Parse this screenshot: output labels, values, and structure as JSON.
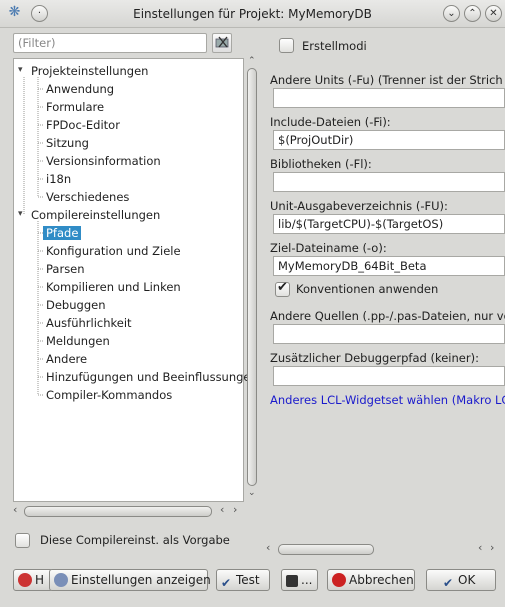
{
  "window": {
    "title": "Einstellungen für Projekt: MyMemoryDB"
  },
  "filter": {
    "placeholder": "(Filter)"
  },
  "tree": {
    "group1": "Projekteinstellungen",
    "group1_items": [
      "Anwendung",
      "Formulare",
      "FPDoc-Editor",
      "Sitzung",
      "Versionsinformation",
      "i18n",
      "Verschiedenes"
    ],
    "group2": "Compilereinstellungen",
    "group2_items": [
      "Pfade",
      "Konfiguration und Ziele",
      "Parsen",
      "Kompilieren und Linken",
      "Debuggen",
      "Ausführlichkeit",
      "Meldungen",
      "Andere",
      "Hinzufügungen und Beeinflussungen",
      "Compiler-Kommandos"
    ],
    "selected": "Pfade"
  },
  "default_checkbox": {
    "label": "Diese Compilereinst. als Vorgabe"
  },
  "paths": {
    "buildmodes": "Erstellmodi",
    "other_units_label": "Andere Units (-Fu) (Trenner ist der Strich",
    "other_units_value": "",
    "include_label": "Include-Dateien (-Fi):",
    "include_value": "$(ProjOutDir)",
    "libraries_label": "Bibliotheken (-Fl):",
    "libraries_value": "",
    "unit_output_label": "Unit-Ausgabeverzeichnis (-FU):",
    "unit_output_value": "lib/$(TargetCPU)-$(TargetOS)",
    "target_label": "Ziel-Dateiname (-o):",
    "target_value": "MyMemoryDB_64Bit_Beta",
    "conventions_label": "Konventionen anwenden",
    "other_sources_label": "Andere Quellen (.pp-/.pas-Dateien, nur vo",
    "other_sources_value": "",
    "debugger_label": "Zusätzlicher Debuggerpfad (keiner):",
    "debugger_value": "",
    "lcl_link": "Anderes LCL-Widgetset wählen (Makro LC"
  },
  "buttons": {
    "help": "H",
    "show_options": "Einstellungen anzeigen",
    "test": "Test",
    "save": "...",
    "cancel": "Abbrechen",
    "ok": "OK"
  }
}
